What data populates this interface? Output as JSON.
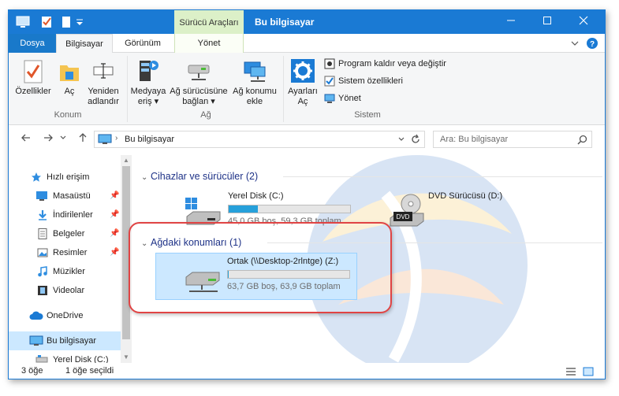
{
  "title_bar": {
    "tool_tab": "Sürücü Araçları",
    "title": "Bu bilgisayar"
  },
  "ribbon_tabs": [
    "Dosya",
    "Bilgisayar",
    "Görünüm",
    "Yönet"
  ],
  "ribbon": {
    "konum": {
      "label": "Konum",
      "buttons": [
        "Özellikler",
        "Aç",
        "Yeniden",
        "adlandır"
      ]
    },
    "ag": {
      "label": "Ağ",
      "media_l1": "Medyaya",
      "media_l2": "eriş ▾",
      "map_l1": "Ağ sürücüsüne",
      "map_l2": "bağlan ▾",
      "add_l1": "Ağ konumu",
      "add_l2": "ekle"
    },
    "sistem": {
      "label": "Sistem",
      "settings_l1": "Ayarları",
      "settings_l2": "Aç",
      "small": [
        "Program kaldır veya değiştir",
        "Sistem özellikleri",
        "Yönet"
      ]
    }
  },
  "address": {
    "path": "Bu bilgisayar",
    "search_placeholder": "Ara: Bu bilgisayar"
  },
  "nav_items": [
    {
      "label": "Hızlı erişim",
      "icon": "star-icon"
    },
    {
      "label": "Masaüstü",
      "icon": "desktop-icon"
    },
    {
      "label": "İndirilenler",
      "icon": "download-icon"
    },
    {
      "label": "Belgeler",
      "icon": "documents-icon"
    },
    {
      "label": "Resimler",
      "icon": "pictures-icon"
    },
    {
      "label": "Müzikler",
      "icon": "music-icon"
    },
    {
      "label": "Videolar",
      "icon": "videos-icon"
    },
    {
      "label": "OneDrive",
      "icon": "cloud-icon"
    },
    {
      "label": "Bu bilgisayar",
      "icon": "computer-icon"
    },
    {
      "label": "Yerel Disk (C:)",
      "icon": "drive-icon"
    }
  ],
  "groups": {
    "devices": "Cihazlar ve sürücüler (2)",
    "network": "Ağdaki konumları (1)"
  },
  "drives": {
    "c": {
      "name": "Yerel Disk (C:)",
      "free_text": "45,0 GB boş, 59,3 GB toplam",
      "used_fraction": 0.24
    },
    "dvd": {
      "name": "DVD Sürücüsü (D:)",
      "badge": "DVD"
    },
    "z": {
      "name": "Ortak (\\\\Desktop-2rlntge) (Z:)",
      "free_text": "63,7 GB boş, 63,9 GB toplam",
      "used_fraction": 0.003
    }
  },
  "status": {
    "count": "3 öğe",
    "selected": "1 öğe seçildi"
  },
  "colors": {
    "accent": "#1a7ad4",
    "tool_tab": "#dcf0c8",
    "bar_fill": "#26a0da",
    "selection": "#cce8ff",
    "highlight": "#e04444"
  }
}
